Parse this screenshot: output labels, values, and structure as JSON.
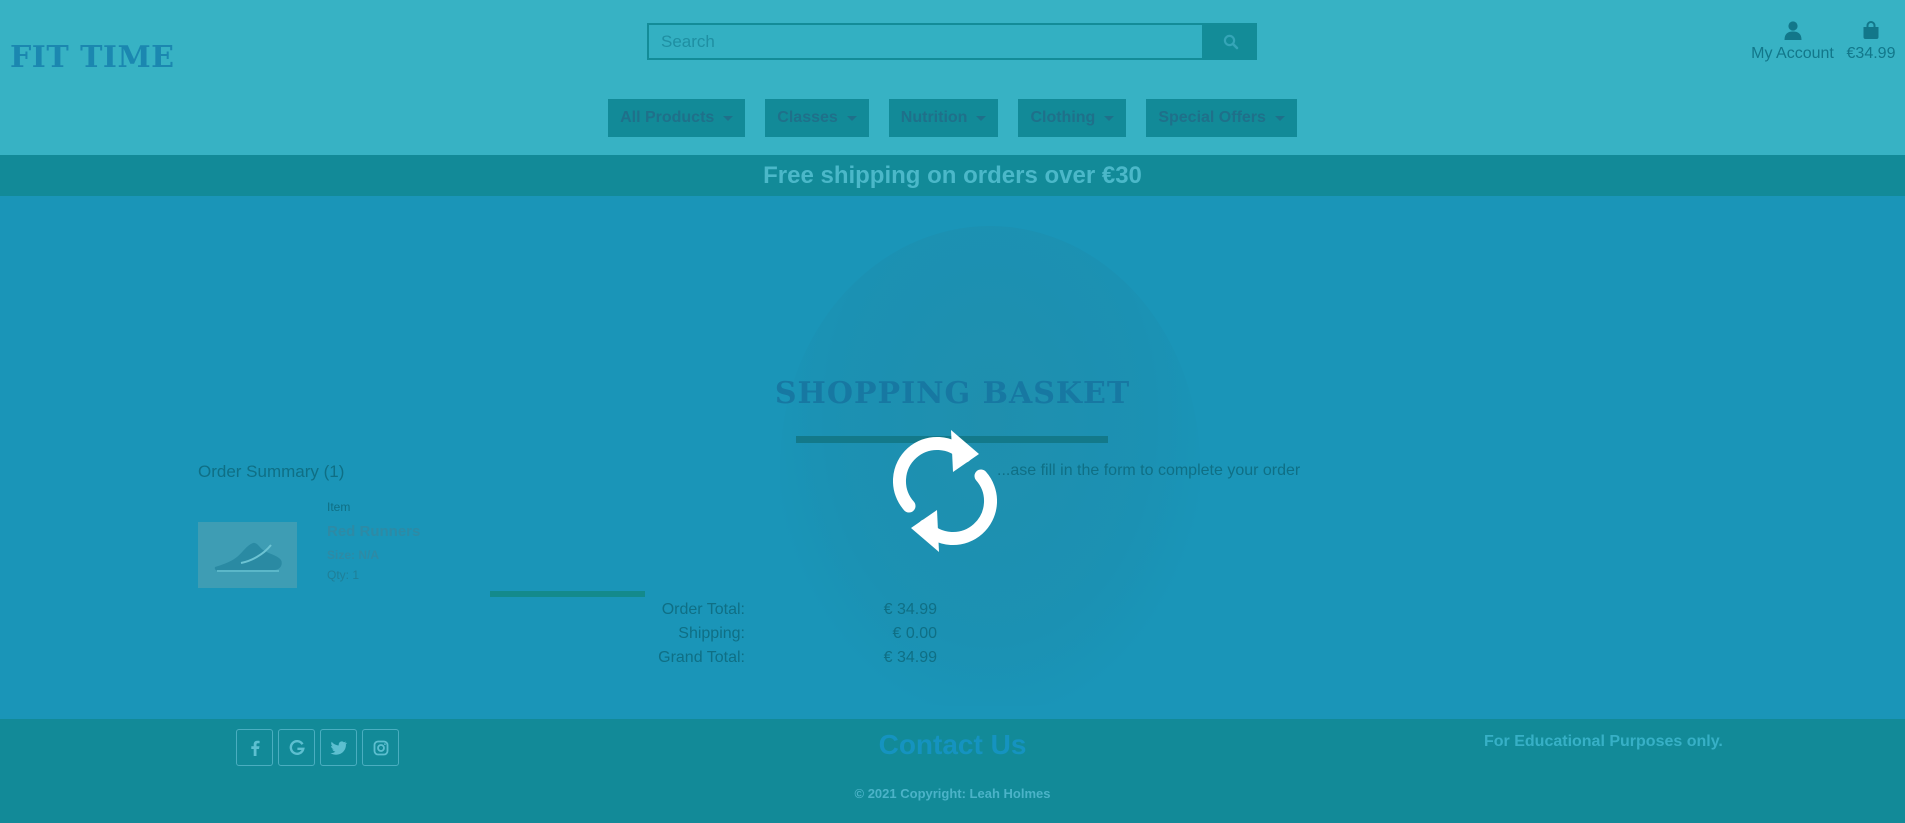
{
  "brand": {
    "logo": "FIT TIME"
  },
  "search": {
    "placeholder": "Search",
    "icon": "search-icon"
  },
  "header": {
    "account_label": "My Account",
    "basket_total": "€34.99"
  },
  "nav": {
    "items": [
      {
        "label": "All Products"
      },
      {
        "label": "Classes"
      },
      {
        "label": "Nutrition"
      },
      {
        "label": "Clothing"
      },
      {
        "label": "Special Offers"
      }
    ]
  },
  "banner": {
    "text": "Free shipping on orders over €30"
  },
  "page": {
    "title": "SHOPPING BASKET",
    "order_summary": "Order Summary (1)",
    "instructions": "...ase fill in the form to complete your order",
    "item_header": "Item",
    "item": {
      "name": "Red Runners",
      "size": "Size: N/A",
      "qty": "Qty: 1"
    },
    "totals": {
      "order_total_label": "Order Total:",
      "order_total_value": "€ 34.99",
      "shipping_label": "Shipping:",
      "shipping_value": "€ 0.00",
      "grand_total_label": "Grand Total:",
      "grand_total_value": "€ 34.99"
    }
  },
  "overlay": {
    "icon": "sync-icon"
  },
  "footer": {
    "social": [
      "facebook-icon",
      "google-icon",
      "twitter-icon",
      "instagram-icon"
    ],
    "contact": "Contact Us",
    "note": "For Educational Purposes only.",
    "copyright": "© 2021 Copyright: Leah Holmes"
  },
  "colors": {
    "header_bg": "#37b2c4",
    "overlay_main": "#1a95b8",
    "accent": "#128a98",
    "spinner": "#ffffff"
  }
}
